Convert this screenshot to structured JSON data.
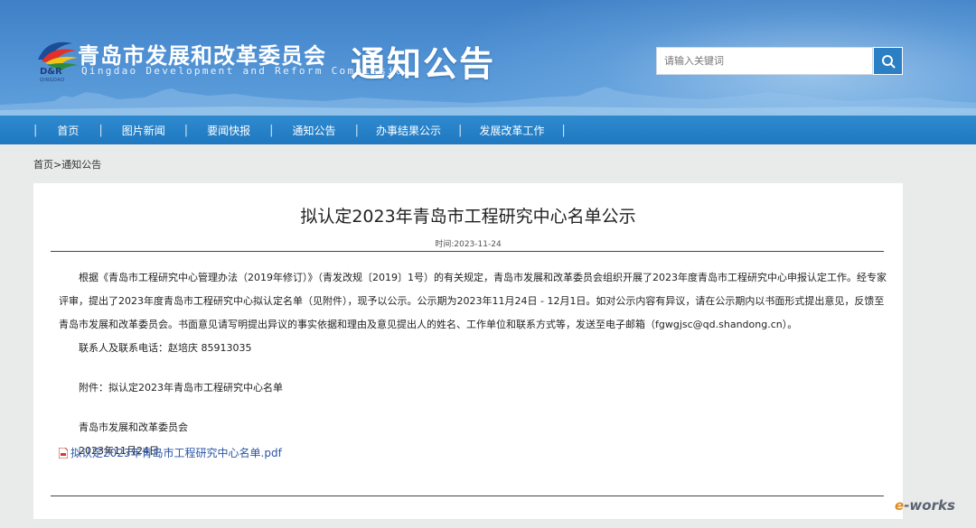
{
  "header": {
    "site_name": "青岛市发展和改革委员会",
    "site_name_en": "Qingdao Development and Reform Commission",
    "logo_abbr": "D&R",
    "logo_sub": "QINGDAO",
    "section_title": "通知公告",
    "search": {
      "placeholder": "请输入关键词"
    },
    "colors": {
      "banner": "#4a8bcf",
      "nav": "#1f78c0",
      "accent": "#2b7fc4"
    }
  },
  "nav": {
    "items": [
      {
        "label": "首页"
      },
      {
        "label": "图片新闻"
      },
      {
        "label": "要闻快报"
      },
      {
        "label": "通知公告"
      },
      {
        "label": "办事结果公示"
      },
      {
        "label": "发展改革工作"
      }
    ]
  },
  "breadcrumb": {
    "home": "首页",
    "sep": ">",
    "current": "通知公告"
  },
  "article": {
    "title": "拟认定2023年青岛市工程研究中心名单公示",
    "time": "时间:2023-11-24",
    "paragraph": "根据《青岛市工程研究中心管理办法（2019年修订）》（青发改规〔2019〕1号）的有关规定，青岛市发展和改革委员会组织开展了2023年度青岛市工程研究中心申报认定工作。经专家评审，提出了2023年度青岛市工程研究中心拟认定名单（见附件），现予以公示。公示期为2023年11月24日 - 12月1日。如对公示内容有异议，请在公示期内以书面形式提出意见，反馈至青岛市发展和改革委员会。书面意见请写明提出异议的事实依据和理由及意见提出人的姓名、工作单位和联系方式等，发送至电子邮箱（fgwgjsc@qd.shandong.cn）。",
    "contact": "联系人及联系电话：赵培庆    85913035",
    "attachment": "附件：拟认定2023年青岛市工程研究中心名单",
    "issuer": "青岛市发展和改革委员会",
    "date": "2023年11月24日",
    "pdf_link": "拟认定2023年青岛市工程研究中心名单.pdf"
  },
  "watermark": {
    "prefix": "e",
    "text": "-works"
  }
}
